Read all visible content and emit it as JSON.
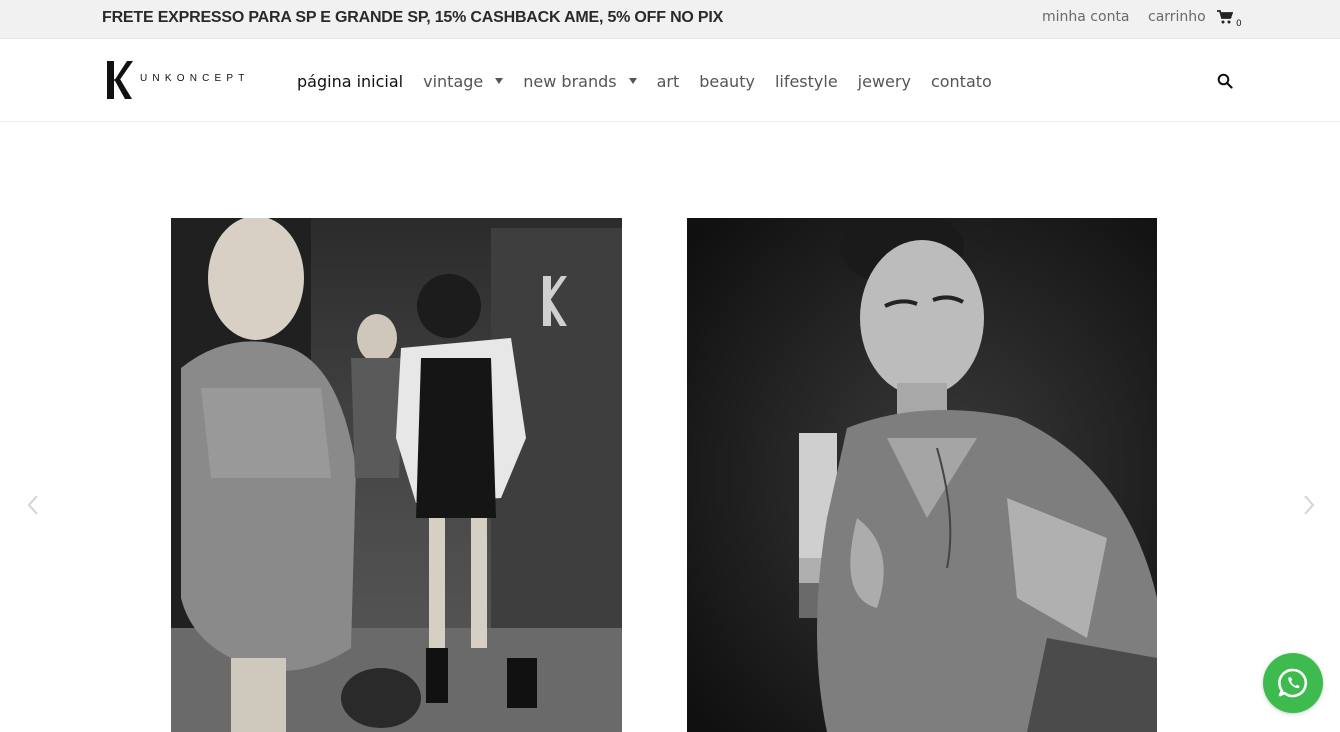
{
  "topbar": {
    "promo": "FRETE EXPRESSO PARA SP E GRANDE SP, 15% CASHBACK AME, 5% OFF NO PIX",
    "account": "minha conta",
    "cart_label": "carrinho",
    "cart_count": "0",
    "cart_icon": "cart-icon"
  },
  "header": {
    "logo_mark": "K",
    "logo_word": "UNKONCEPT",
    "nav": [
      {
        "label": "página inicial",
        "active": true
      },
      {
        "label": "vintage",
        "dropdown": true
      },
      {
        "label": "new brands",
        "dropdown": true
      },
      {
        "label": "art"
      },
      {
        "label": "beauty"
      },
      {
        "label": "lifestyle"
      },
      {
        "label": "jewery"
      },
      {
        "label": "contato"
      }
    ],
    "search_icon": "search-icon"
  },
  "slider": {
    "prev_icon": "chevron-left-icon",
    "next_icon": "chevron-right-icon",
    "slides": [
      {
        "name": "editorial-photo-women"
      },
      {
        "name": "editorial-photo-man"
      }
    ]
  },
  "whatsapp": {
    "icon": "whatsapp-icon",
    "color": "#3dbb4e"
  }
}
